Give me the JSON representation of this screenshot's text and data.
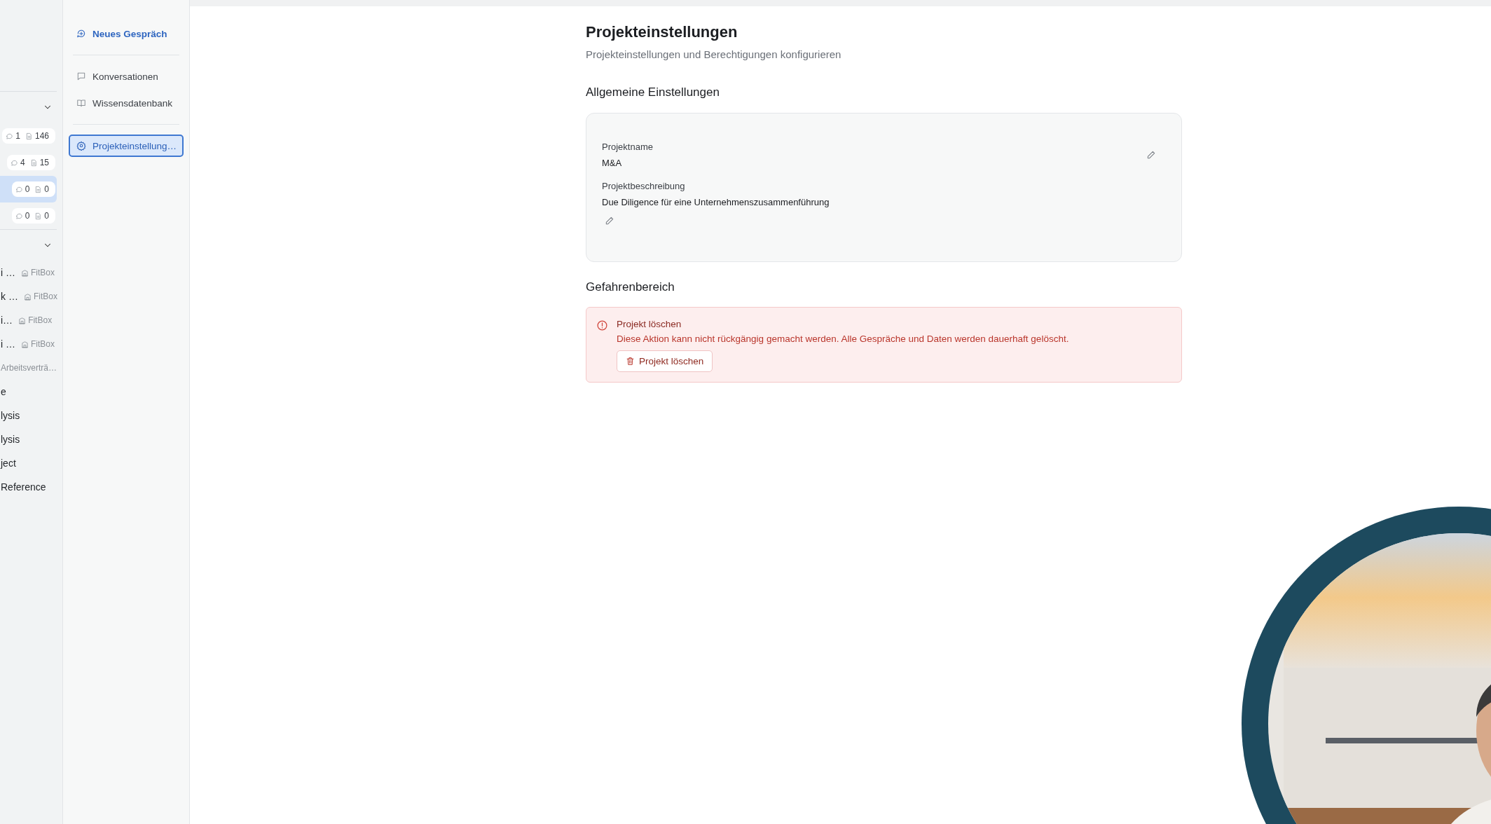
{
  "project_list": {
    "sections": [
      {
        "expanded": true,
        "rows": [
          {
            "chats": "1",
            "docs": "146",
            "selected": false
          },
          {
            "chats": "4",
            "docs": "15",
            "selected": false
          },
          {
            "chats": "0",
            "docs": "0",
            "selected": true
          },
          {
            "chats": "0",
            "docs": "0",
            "selected": false
          }
        ]
      },
      {
        "expanded": true,
        "rows": [
          {
            "label": "i …",
            "tag": "FitBox"
          },
          {
            "label": "k …",
            "tag": "FitBox"
          },
          {
            "label": "i…",
            "tag": "FitBox"
          },
          {
            "label": "i …",
            "tag": "FitBox"
          },
          {
            "tag": "Arbeitsverträ…"
          },
          {
            "label": "e"
          },
          {
            "label": "lysis"
          },
          {
            "label": "lysis"
          },
          {
            "label": "ject"
          },
          {
            "label": "Reference"
          }
        ]
      }
    ]
  },
  "project_nav": {
    "groups": [
      [
        {
          "label": "Neues Gespräch",
          "kind": "action",
          "selected": false
        }
      ],
      [
        {
          "label": "Konversationen",
          "kind": "link",
          "selected": false
        },
        {
          "label": "Wissensdatenbank",
          "kind": "link",
          "selected": false
        }
      ],
      [
        {
          "label": "Projekteinstellung…",
          "kind": "link",
          "selected": true
        }
      ]
    ]
  },
  "main": {
    "title": "Projekteinstellungen",
    "subtitle": "Projekteinstellungen und Berechtigungen konfigurieren",
    "general": {
      "heading": "Allgemeine Einstellungen",
      "fields": [
        {
          "label": "Projektname",
          "value": "M&A"
        },
        {
          "label": "Projektbeschreibung",
          "value": "Due Diligence für eine Unternehmenszusammenführung"
        }
      ]
    },
    "danger": {
      "heading": "Gefahrenbereich",
      "title": "Projekt löschen",
      "text": "Diese Aktion kann nicht rückgängig gemacht werden. Alle Gespräche und Daten werden dauerhaft gelöscht.",
      "button": "Projekt löschen"
    }
  }
}
